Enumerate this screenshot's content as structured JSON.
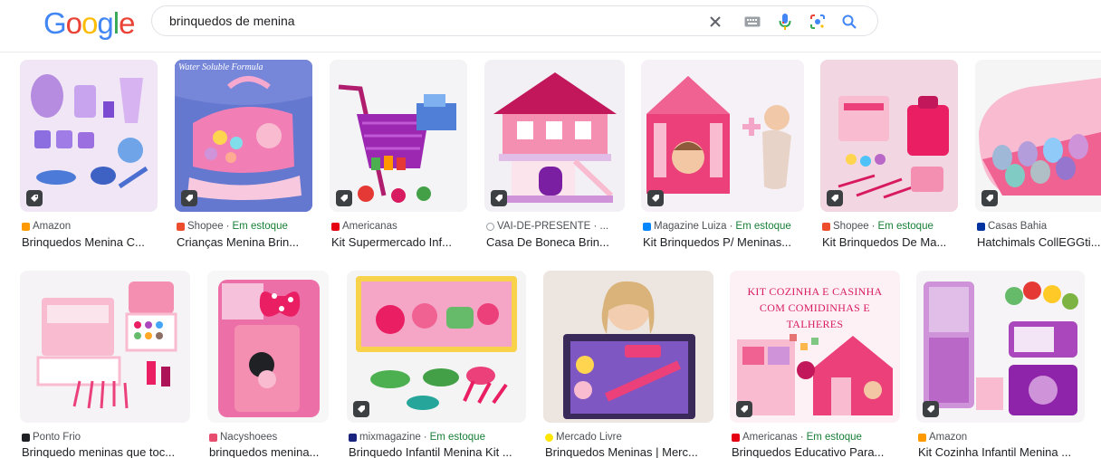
{
  "search": {
    "query": "brinquedos de menina",
    "clear_icon": "close-icon",
    "keyboard_icon": "keyboard-icon",
    "voice_icon": "mic-icon",
    "lens_icon": "lens-icon",
    "search_icon": "search-icon"
  },
  "logo": {
    "letters": [
      "G",
      "o",
      "o",
      "g",
      "l",
      "e"
    ],
    "colors": [
      "#4285f4",
      "#ea4335",
      "#fbbc05",
      "#4285f4",
      "#34a853",
      "#ea4335"
    ]
  },
  "results": [
    {
      "source": "Amazon",
      "stock": "",
      "title": "Brinquedos Menina C...",
      "fav": "#ff9900",
      "bg": "#f0e6f5"
    },
    {
      "source": "Shopee",
      "stock": "Em estoque",
      "title": "Crianças Menina Brin...",
      "fav": "#ee4d2d",
      "bg": "#5b6fc9",
      "overlay": "Water Soluble Formula"
    },
    {
      "source": "Americanas",
      "stock": "",
      "title": "Kit Supermercado Inf...",
      "fav": "#e60014",
      "bg": "#f4f4f6"
    },
    {
      "source": "VAI-DE-PRESENTE · ...",
      "stock": "",
      "title": "Casa De Boneca Brin...",
      "fav": "#9aa0a6",
      "bg": "#f2f0f4"
    },
    {
      "source": "Magazine Luiza",
      "stock": "Em estoque",
      "title": "Kit Brinquedos P/ Meninas...",
      "fav": "#0086ff",
      "bg": "#f6f0f7"
    },
    {
      "source": "Shopee",
      "stock": "Em estoque",
      "title": "Kit Brinquedos De Ma...",
      "fav": "#ee4d2d",
      "bg": "#f4dde6"
    },
    {
      "source": "Casas Bahia",
      "stock": "",
      "title": "Hatchimals CollEGGti...",
      "fav": "#0033a0",
      "bg": "#f5f5f5"
    },
    {
      "source": "Ponto Frio",
      "stock": "",
      "title": "Brinquedo meninas que toc...",
      "fav": "#202124",
      "bg": "#f5f3f5"
    },
    {
      "source": "Nacyshoees",
      "stock": "",
      "title": "brinquedos menina...",
      "fav": "#e84c6f",
      "bg": "#f7f7f7"
    },
    {
      "source": "mixmagazine",
      "stock": "Em estoque",
      "title": "Brinquedo Infantil Menina Kit ...",
      "fav": "#1a237e",
      "bg": "#f4f4f4"
    },
    {
      "source": "Mercado Livre",
      "stock": "",
      "title": "Brinquedos Meninas | Merc...",
      "fav": "#ffe600",
      "bg": "#efe9e4"
    },
    {
      "source": "Americanas",
      "stock": "Em estoque",
      "title": "Brinquedos Educativo Para...",
      "fav": "#e60014",
      "bg": "#fdf0f4",
      "overlay": "KIT COZINHA E CASINHA COM COMIDINHAS E TALHERES"
    },
    {
      "source": "Amazon",
      "stock": "",
      "title": "Kit Cozinha Infantil Menina ...",
      "fav": "#ff9900",
      "bg": "#f7f4f7"
    }
  ]
}
